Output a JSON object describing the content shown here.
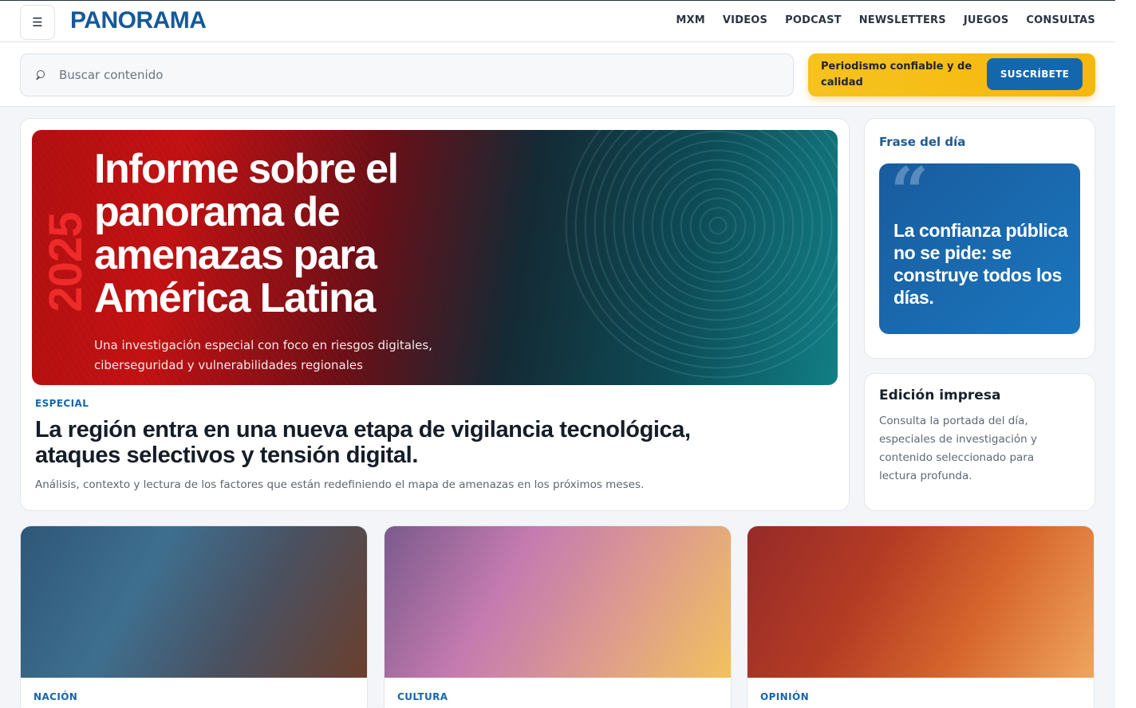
{
  "header": {
    "menu_icon": "☰",
    "logo": "PANORAMA",
    "nav": [
      "MXM",
      "VIDEOS",
      "PODCAST",
      "NEWSLETTERS",
      "JUEGOS",
      "CONSULTAS"
    ]
  },
  "search": {
    "placeholder": "Buscar contenido",
    "icon": "search-icon"
  },
  "promo": {
    "text": "Periodismo confiable y de calidad",
    "button": "SUSCRÍBETE"
  },
  "feature": {
    "hero_year": "2025",
    "hero_title": "Informe sobre el panorama de amenazas para América Latina",
    "hero_subtitle": "Una investigación especial con foco en riesgos digitales, ciberseguridad y vulnerabilidades regionales",
    "kicker": "ESPECIAL",
    "headline": "La región entra en una nueva etapa de vigilancia tecnológica, ataques selectivos y tensión digital.",
    "dek": "Análisis, contexto y lectura de los factores que están redefiniendo el mapa de amenazas en los próximos meses."
  },
  "quote_card": {
    "title": "Frase del día",
    "quote_mark": "“",
    "quote": "La confianza pública no se pide: se construye todos los días."
  },
  "print_card": {
    "title": "Edición impresa",
    "text": "Consulta la portada del día, especiales de investigación y contenido seleccionado para lectura profunda."
  },
  "cards": [
    {
      "tag": "NACIÓN"
    },
    {
      "tag": "CULTURA"
    },
    {
      "tag": "OPINIÓN"
    }
  ],
  "colors": {
    "brand": "#16599a",
    "accent": "#1566ad",
    "promo": "#f5b80c"
  }
}
